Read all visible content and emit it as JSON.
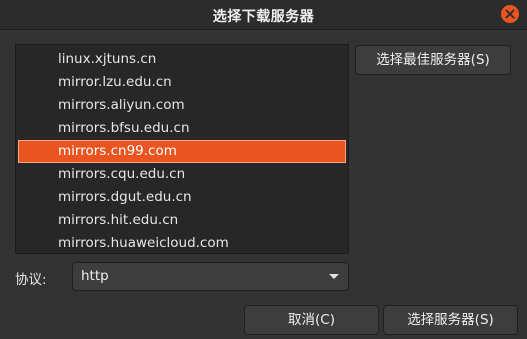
{
  "window": {
    "title": "选择下载服务器"
  },
  "mirror_list": {
    "items": [
      {
        "label": "linux.xjtuns.cn",
        "selected": false
      },
      {
        "label": "mirror.lzu.edu.cn",
        "selected": false
      },
      {
        "label": "mirrors.aliyun.com",
        "selected": false
      },
      {
        "label": "mirrors.bfsu.edu.cn",
        "selected": false
      },
      {
        "label": "mirrors.cn99.com",
        "selected": true
      },
      {
        "label": "mirrors.cqu.edu.cn",
        "selected": false
      },
      {
        "label": "mirrors.dgut.edu.cn",
        "selected": false
      },
      {
        "label": "mirrors.hit.edu.cn",
        "selected": false
      },
      {
        "label": "mirrors.huaweicloud.com",
        "selected": false
      }
    ]
  },
  "buttons": {
    "select_best": "选择最佳服务器(S)",
    "cancel": "取消(C)",
    "select_server": "选择服务器(S)"
  },
  "protocol": {
    "label": "协议:",
    "value": "http"
  },
  "colors": {
    "accent": "#e95420",
    "background": "#333333",
    "list_background": "#272727"
  },
  "icons": {
    "close": "close-icon",
    "dropdown": "chevron-down-icon"
  }
}
